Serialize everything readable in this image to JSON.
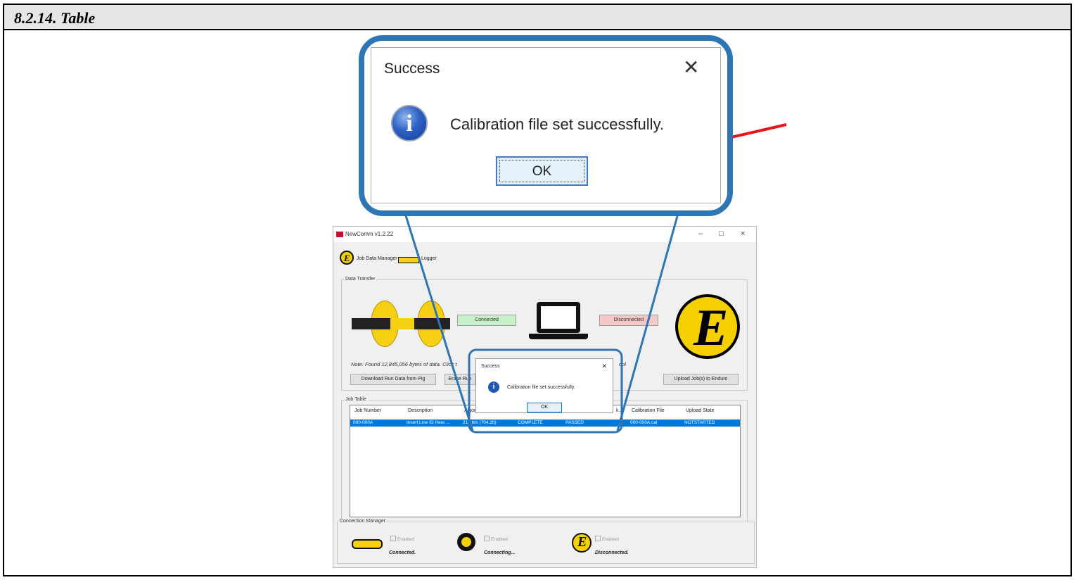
{
  "section_title": "8.2.14. Table",
  "zoomed_dialog": {
    "title": "Success",
    "message": "Calibration file set successfully.",
    "ok_label": "OK"
  },
  "app_window": {
    "title": "NewComm v1.2.22",
    "tabs": [
      {
        "label": "Job Data Manager",
        "icon": "enduro-e-icon"
      },
      {
        "label": "Logger",
        "icon": "pig-icon"
      }
    ],
    "data_transfer": {
      "group_label": "Data Transfer",
      "pig_status": "Connected",
      "enduro_status": "Disconnected",
      "note": "Note: Found 12,845,056 bytes of data. Click t",
      "note_tail": "ool",
      "download_button": "Download Run Data from Pig",
      "erase_button": "Erase Run",
      "upload_button": "Upload Job(s) to Enduro"
    },
    "job_table": {
      "group_label": "Job Table",
      "columns": [
        "Job Number",
        "Description",
        "Algori",
        "k...",
        "Calibration File",
        "Upload State"
      ],
      "rows": [
        {
          "job_number": "000-000A",
          "description": "Insert Line ID Here ...",
          "algorithm": "214.6m (704.2ft)",
          "status": "COMPLETE",
          "validation": "PASSED",
          "calibration_file": "000-000A.cal",
          "upload_state": "NOTSTARTED"
        }
      ]
    },
    "connection_manager": {
      "group_label": "Connection Manager",
      "items": [
        {
          "enabled_label": "Enabled",
          "status": "Connected."
        },
        {
          "enabled_label": "Enabled",
          "status": "Connecting..."
        },
        {
          "enabled_label": "Enabled",
          "status": "Disconnected."
        }
      ]
    },
    "mini_dialog": {
      "title": "Success",
      "message": "Calibration file set successfully.",
      "ok_label": "OK"
    }
  },
  "colors": {
    "callout_border": "#2e75b6",
    "arrow": "#e8141b",
    "status_connected_bg": "#c8f0c8",
    "status_disconnected_bg": "#f5c8c8",
    "selection_blue": "#0078d7"
  }
}
